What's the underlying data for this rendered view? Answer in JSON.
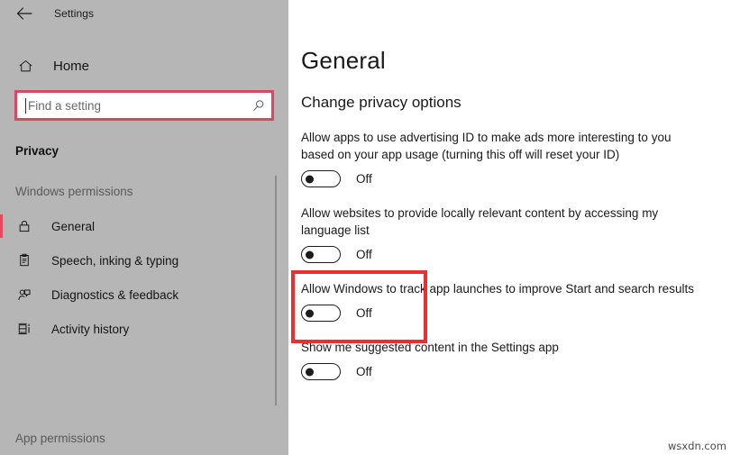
{
  "window": {
    "app_title": "Settings",
    "back_icon": "back-arrow-icon"
  },
  "sidebar": {
    "home": {
      "label": "Home",
      "icon": "home-icon"
    },
    "search": {
      "placeholder": "Find a setting",
      "value": "",
      "icon": "search-icon",
      "border_color": "#d9485f"
    },
    "category_title": "Privacy",
    "sections": [
      {
        "label": "Windows permissions",
        "items": [
          {
            "label": "General",
            "icon": "lock-icon",
            "selected": true
          },
          {
            "label": "Speech, inking & typing",
            "icon": "clipboard-icon",
            "selected": false
          },
          {
            "label": "Diagnostics & feedback",
            "icon": "person-feedback-icon",
            "selected": false
          },
          {
            "label": "Activity history",
            "icon": "timeline-icon",
            "selected": false
          }
        ]
      },
      {
        "label": "App permissions",
        "items": []
      }
    ],
    "accent_color": "#e8485f",
    "background_color": "#b6b6b6"
  },
  "main": {
    "page_title": "General",
    "section_title": "Change privacy options",
    "settings": [
      {
        "text": "Allow apps to use advertising ID to make ads more interesting to you based on your app usage (turning this off will reset your ID)",
        "state": "Off",
        "highlighted": false
      },
      {
        "text": "Allow websites to provide locally relevant content by accessing my language list",
        "state": "Off",
        "highlighted": false
      },
      {
        "text": "Allow Windows to track app launches to improve Start and search results",
        "state": "Off",
        "highlighted": true
      },
      {
        "text": "Show me suggested content in the Settings app",
        "state": "Off",
        "highlighted": false
      }
    ],
    "highlight_color": "#e8302e"
  },
  "watermark": "wsxdn.com"
}
